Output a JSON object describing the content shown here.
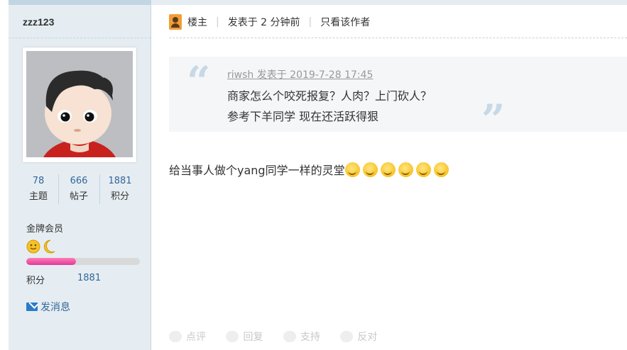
{
  "author": {
    "username": "zzz123",
    "stats": [
      {
        "value": "78",
        "label": "主题"
      },
      {
        "value": "666",
        "label": "帖子"
      },
      {
        "value": "1881",
        "label": "积分"
      }
    ],
    "rank": "金牌会员",
    "rank_progress": 0.44,
    "points_label": "积分",
    "points_value": "1881",
    "send_message": "发消息"
  },
  "post": {
    "owner_label": "楼主",
    "posted": "发表于 2 分钟前",
    "only_author": "只看该作者",
    "quote": {
      "author_line": "riwsh 发表于 2019-7-28 17:45",
      "lines": [
        "商家怎么个咬死报复？人肉？上门砍人？",
        "参考下羊同学 现在还活跃得狠"
      ]
    },
    "body": "给当事人做个yang同学一样的灵堂",
    "emoji_count": 6,
    "emoji_icon": "smirk-emoji-icon",
    "actions": [
      {
        "label": "点评",
        "icon": "comment-icon"
      },
      {
        "label": "回复",
        "icon": "reply-icon"
      },
      {
        "label": "支持",
        "icon": "thumbs-up-icon"
      },
      {
        "label": "反对",
        "icon": "thumbs-down-icon"
      }
    ]
  },
  "colors": {
    "sidebar_bg": "#e5edf2",
    "link": "#336699",
    "quote_bg": "#f4f6f8",
    "progress": "#e0389a"
  }
}
